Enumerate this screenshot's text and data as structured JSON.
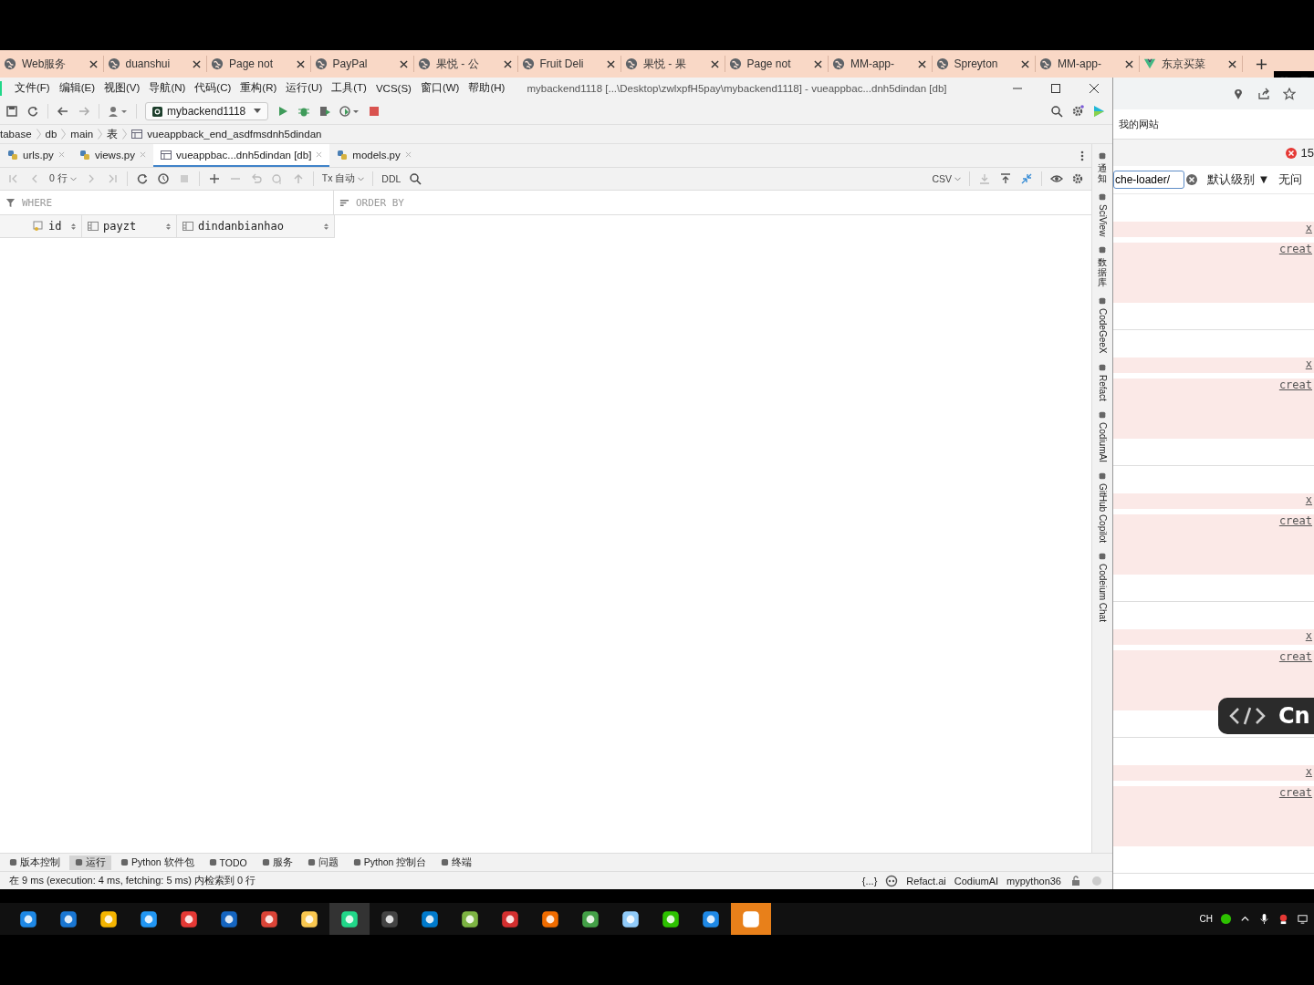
{
  "browser_tabs": [
    {
      "title": "Web服务",
      "kind": "globe"
    },
    {
      "title": "duanshui",
      "kind": "globe"
    },
    {
      "title": "Page not",
      "kind": "globe"
    },
    {
      "title": "PayPal",
      "kind": "globe"
    },
    {
      "title": "果悦 - 公",
      "kind": "globe"
    },
    {
      "title": "Fruit Deli",
      "kind": "globe"
    },
    {
      "title": "果悦 - 果",
      "kind": "globe"
    },
    {
      "title": "Page not",
      "kind": "globe"
    },
    {
      "title": "MM-app-",
      "kind": "globe"
    },
    {
      "title": "Spreyton",
      "kind": "globe"
    },
    {
      "title": "MM-app-",
      "kind": "globe"
    },
    {
      "title": "东京买菜",
      "kind": "vue"
    }
  ],
  "ide": {
    "menu": [
      "文件(F)",
      "编辑(E)",
      "视图(V)",
      "导航(N)",
      "代码(C)",
      "重构(R)",
      "运行(U)",
      "工具(T)",
      "VCS(S)",
      "窗口(W)",
      "帮助(H)"
    ],
    "title": "mybackend1118 [...\\Desktop\\zwlxpfH5pay\\mybackend1118] - vueappbac...dnh5dindan [db]",
    "run_config": "mybackend1118",
    "breadcrumbs": [
      "tabase",
      "db",
      "main",
      "表",
      "vueappback_end_asdfmsdnh5dindan"
    ],
    "editor_tabs": [
      {
        "label": "urls.py",
        "kind": "python",
        "selected": false
      },
      {
        "label": "views.py",
        "kind": "python",
        "selected": false
      },
      {
        "label": "vueappbac...dnh5dindan [db]",
        "kind": "table",
        "selected": true
      },
      {
        "label": "models.py",
        "kind": "python",
        "selected": false
      }
    ],
    "row_count": "0 行",
    "tx_mode": "Tx 自动",
    "ddl": "DDL",
    "export_format": "CSV",
    "where": {
      "placeholder": "WHERE"
    },
    "order_by": {
      "placeholder": "ORDER BY"
    },
    "columns": [
      {
        "name": "id",
        "kind": "key"
      },
      {
        "name": "payzt",
        "kind": "column"
      },
      {
        "name": "dindanbianhao",
        "kind": "column"
      }
    ],
    "side_tools": [
      {
        "label": "通知",
        "kind": "cjk"
      },
      {
        "label": "SciView",
        "kind": "latin"
      },
      {
        "label": "数据库",
        "kind": "cjk"
      },
      {
        "label": "CodeGeeX",
        "kind": "latin"
      },
      {
        "label": "Refact",
        "kind": "latin"
      },
      {
        "label": "CodiumAI",
        "kind": "latin"
      },
      {
        "label": "GitHub Copilot",
        "kind": "latin"
      },
      {
        "label": "Codeium Chat",
        "kind": "latin"
      }
    ],
    "bottom_tools": [
      {
        "label": "版本控制",
        "selected": false
      },
      {
        "label": "运行",
        "selected": true
      },
      {
        "label": "Python 软件包",
        "selected": false
      },
      {
        "label": "TODO",
        "selected": false
      },
      {
        "label": "服务",
        "selected": false
      },
      {
        "label": "问题",
        "selected": false
      },
      {
        "label": "Python 控制台",
        "selected": false
      },
      {
        "label": "终端",
        "selected": false
      }
    ],
    "status": "在 9 ms (execution: 4 ms, fetching: 5 ms) 内检索到 0 行",
    "status_right": {
      "braces": "{...}",
      "refact": "Refact.ai",
      "codium": "CodiumAI",
      "interpreter": "mypython36"
    }
  },
  "browser": {
    "bookmark": "我的网站",
    "error_count": "15",
    "filter": {
      "value": "che-loader/"
    },
    "level_menu": "默认级别 ▼",
    "issues": "无问",
    "entries": [
      {
        "close": "x",
        "link": "creat"
      },
      {
        "close": "x",
        "link": "creat"
      },
      {
        "close": "x",
        "link": "creat"
      },
      {
        "close": "x",
        "link": "creat"
      },
      {
        "close": "x",
        "link": "creat"
      }
    ],
    "overlay": "Cn"
  },
  "taskbar": {
    "apps": [
      {
        "kind": "search",
        "selected": false
      },
      {
        "kind": "edge",
        "selected": false
      },
      {
        "kind": "ring",
        "selected": false
      },
      {
        "kind": "ie",
        "selected": false
      },
      {
        "kind": "camera",
        "selected": false
      },
      {
        "kind": "circle",
        "selected": false
      },
      {
        "kind": "chrome",
        "selected": false
      },
      {
        "kind": "folder",
        "selected": false
      },
      {
        "kind": "pycharm",
        "selected": true
      },
      {
        "kind": "terminal",
        "selected": false
      },
      {
        "kind": "vscode",
        "selected": false
      },
      {
        "kind": "notepad",
        "selected": false
      },
      {
        "kind": "wps",
        "selected": false
      },
      {
        "kind": "swirl",
        "selected": false
      },
      {
        "kind": "game",
        "selected": false
      },
      {
        "kind": "book",
        "selected": false
      },
      {
        "kind": "wechat",
        "selected": false
      },
      {
        "kind": "player",
        "selected": false
      },
      {
        "kind": "meeting",
        "selected": true
      }
    ],
    "language": "CH"
  }
}
